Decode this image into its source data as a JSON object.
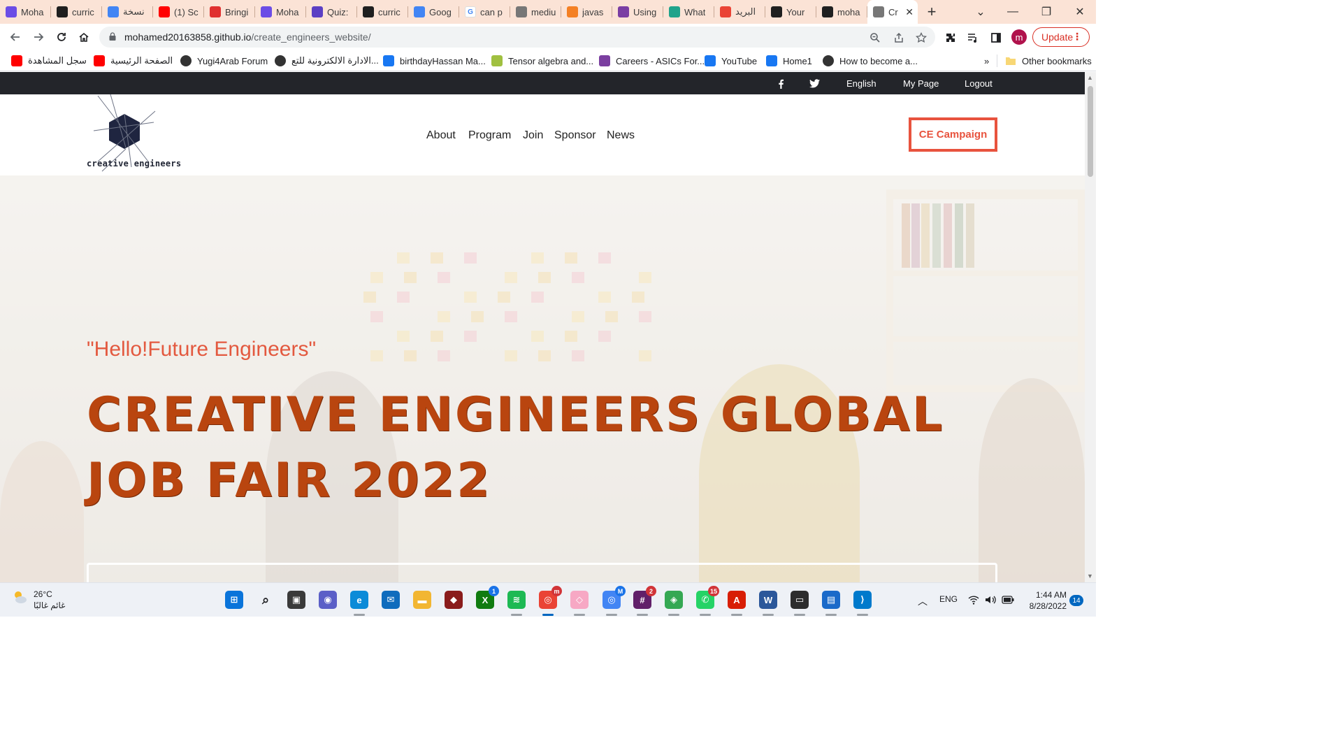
{
  "browser": {
    "tabs": [
      {
        "title": "Moha",
        "icon": "moha-icon",
        "color": "#6b4de6"
      },
      {
        "title": "curric",
        "icon": "github-icon",
        "color": "#1f1f1f"
      },
      {
        "title": "نسخة",
        "icon": "docs-icon",
        "color": "#4285f4"
      },
      {
        "title": "(1) Sc",
        "icon": "youtube-icon",
        "color": "#ff0000"
      },
      {
        "title": "Bringi",
        "icon": "s-icon",
        "color": "#e0302f"
      },
      {
        "title": "Moha",
        "icon": "moha-icon",
        "color": "#6b4de6"
      },
      {
        "title": "Quiz:",
        "icon": "quiz-icon",
        "color": "#5b3fc4"
      },
      {
        "title": "curric",
        "icon": "github-icon",
        "color": "#1f1f1f"
      },
      {
        "title": "Goog",
        "icon": "translate-icon",
        "color": "#4285f4"
      },
      {
        "title": "can p",
        "icon": "google-icon",
        "color": "#ffffff"
      },
      {
        "title": "mediu",
        "icon": "globe-icon",
        "color": "#777777"
      },
      {
        "title": "javas",
        "icon": "stackoverflow-icon",
        "color": "#f48024"
      },
      {
        "title": "Using",
        "icon": "pen-icon",
        "color": "#7a3ea3"
      },
      {
        "title": "What",
        "icon": "eye-icon",
        "color": "#20a38b"
      },
      {
        "title": "البريد",
        "icon": "gmail-icon",
        "color": "#ea4335"
      },
      {
        "title": "Your",
        "icon": "github-icon",
        "color": "#1f1f1f"
      },
      {
        "title": "moha",
        "icon": "github-icon",
        "color": "#1f1f1f"
      },
      {
        "title": "Cr",
        "icon": "globe-icon",
        "color": "#777777"
      }
    ],
    "new_tab": "+",
    "window_controls": {
      "dropdown": "⌄",
      "minimize": "—",
      "restore": "❐",
      "close": "✕"
    },
    "url_host": "mohamed20163858.github.io",
    "url_path": "/create_engineers_website/",
    "update_label": "Update",
    "profile_initial": "m",
    "bookmarks": [
      {
        "label": "سجل المشاهدة",
        "icon": "youtube-icon",
        "color": "#ff0000"
      },
      {
        "label": "الصفحة الرئيسية",
        "icon": "youtube-icon",
        "color": "#ff0000"
      },
      {
        "label": "Yugi4Arab Forum",
        "icon": "globe-icon",
        "color": "#333333"
      },
      {
        "label": "الادارة الالكترونية للتع...",
        "icon": "globe-icon",
        "color": "#333333"
      },
      {
        "label": "birthdayHassan Ma...",
        "icon": "facebook-icon",
        "color": "#1877f2"
      },
      {
        "label": "Tensor algebra and...",
        "icon": "tensor-icon",
        "color": "#a0c040"
      },
      {
        "label": "Careers - ASICs For...",
        "icon": "feather-icon",
        "color": "#7b3fa0"
      },
      {
        "label": "YouTube",
        "icon": "facebook-icon",
        "color": "#1877f2"
      },
      {
        "label": "Home1",
        "icon": "facebook-square-icon",
        "color": "#1877f2"
      },
      {
        "label": "How to become a...",
        "icon": "globe-icon",
        "color": "#333333"
      }
    ],
    "more_bookmarks": "»",
    "other_bookmarks": "Other bookmarks"
  },
  "site": {
    "topbar": {
      "language": "English",
      "my_page": "My Page",
      "logout": "Logout"
    },
    "logo_text": "creative engineers",
    "nav": [
      "About",
      "Program",
      "Join",
      "Sponsor",
      "News"
    ],
    "cta": "CE Campaign",
    "hero": {
      "greeting": "\"Hello!Future Engineers\"",
      "title": "CREATIVE ENGINEERS GLOBAL JOB FAIR 2022"
    },
    "accent_color": "#e8533e",
    "title_color": "#b9450f"
  },
  "taskbar": {
    "weather_temp": "26°C",
    "weather_desc": "غائم غالبًا",
    "apps": [
      {
        "name": "windows-start-icon",
        "badge": ""
      },
      {
        "name": "search-icon",
        "badge": ""
      },
      {
        "name": "task-view-icon",
        "badge": ""
      },
      {
        "name": "teams-chat-icon",
        "badge": ""
      },
      {
        "name": "edge-icon",
        "badge": ""
      },
      {
        "name": "mail-icon",
        "badge": ""
      },
      {
        "name": "file-explorer-icon",
        "badge": ""
      },
      {
        "name": "game-icon",
        "badge": ""
      },
      {
        "name": "xbox-icon",
        "badge": "1"
      },
      {
        "name": "spotify-icon",
        "badge": ""
      },
      {
        "name": "chrome-icon",
        "badge": "m"
      },
      {
        "name": "sketch-icon",
        "badge": ""
      },
      {
        "name": "chrome-profile-icon",
        "badge": "M"
      },
      {
        "name": "slack-icon",
        "badge": "2"
      },
      {
        "name": "maps-icon",
        "badge": ""
      },
      {
        "name": "whatsapp-icon",
        "badge": "15"
      },
      {
        "name": "acrobat-icon",
        "badge": ""
      },
      {
        "name": "word-icon",
        "badge": ""
      },
      {
        "name": "terminal-icon",
        "badge": ""
      },
      {
        "name": "notepad-icon",
        "badge": ""
      },
      {
        "name": "vscode-icon",
        "badge": ""
      }
    ],
    "language": "ENG",
    "time": "1:44 AM",
    "date": "8/28/2022",
    "notifications": "14"
  }
}
